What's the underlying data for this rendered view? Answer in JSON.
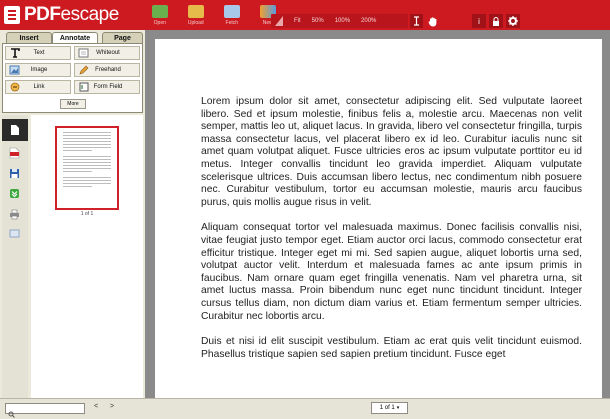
{
  "app": {
    "logo_text_bold": "PDF",
    "logo_text_light": "escape"
  },
  "toolbar": {
    "tools": [
      {
        "label": "Open",
        "icon": "open-folder-icon"
      },
      {
        "label": "Upload",
        "icon": "upload-folder-icon"
      },
      {
        "label": "Fetch",
        "icon": "fetch-icon"
      },
      {
        "label": "New",
        "icon": "new-document-icon"
      }
    ],
    "zoom_options": [
      "Fit",
      "50%",
      "100%",
      "200%"
    ],
    "text_tool_icon": "text-cursor-icon",
    "hand_tool_icon": "hand-icon",
    "info_label": "i",
    "lock_icon": "lock-icon",
    "settings_icon": "gear-icon"
  },
  "sidebar": {
    "tabs": [
      "Insert",
      "Annotate",
      "Page"
    ],
    "active_tab": "Annotate",
    "tool_buttons": [
      {
        "label": "Text",
        "icon": "text-t-icon"
      },
      {
        "label": "Whiteout",
        "icon": "whiteout-icon"
      },
      {
        "label": "Image",
        "icon": "image-icon"
      },
      {
        "label": "Freehand",
        "icon": "pencil-icon"
      },
      {
        "label": "Link",
        "icon": "link-icon"
      },
      {
        "label": "Form Field",
        "icon": "form-field-icon"
      }
    ],
    "more_label": "More",
    "thumbnail_label": "1 of 1"
  },
  "document": {
    "paragraphs": [
      "Lorem ipsum dolor sit amet, consectetur adipiscing elit. Sed vulputate laoreet libero. Sed et ipsum molestie, finibus felis a, molestie arcu. Maecenas non velit semper, mattis leo ut, aliquet lacus. In gravida, libero vel consectetur fringilla, turpis massa consectetur lacus, vel placerat libero ex id leo. Curabitur iaculis nunc sit amet quam volutpat aliquet. Fusce ultricies eros ac ipsum vulputate porttitor eu id metus. Integer convallis tincidunt leo gravida imperdiet. Aliquam vulputate scelerisque ultrices. Duis accumsan libero lectus, nec condimentum nibh posuere nec. Curabitur vestibulum, tortor eu accumsan molestie, mauris arcu faucibus purus, quis mollis augue risus in velit.",
      "Aliquam consequat tortor vel malesuada maximus. Donec facilisis convallis nisi, vitae feugiat justo tempor eget. Etiam auctor orci lacus, commodo consectetur erat efficitur tristique. Integer eget mi mi. Sed sapien augue, aliquet lobortis urna sed, volutpat auctor velit. Interdum et malesuada fames ac ante ipsum primis in faucibus. Nam ornare quam eget fringilla venenatis. Nam vel pharetra urna, sit amet luctus massa. Proin bibendum nunc eget nunc tincidunt tincidunt. Integer cursus tellus diam, non dictum diam varius et. Etiam fermentum semper ultricies. Curabitur nec lobortis arcu.",
      "Duis et nisi id elit suscipit vestibulum. Etiam ac erat quis velit tincidunt euismod. Phasellus tristique sapien sed sapien pretium tincidunt. Fusce eget"
    ]
  },
  "bottombar": {
    "search_placeholder": "",
    "prev_label": "<",
    "next_label": ">",
    "page_select": "1 of 1"
  },
  "colors": {
    "brand_red": "#cc1a20",
    "panel_beige": "#ebe9d9",
    "doc_gray": "#8a8a8a"
  }
}
